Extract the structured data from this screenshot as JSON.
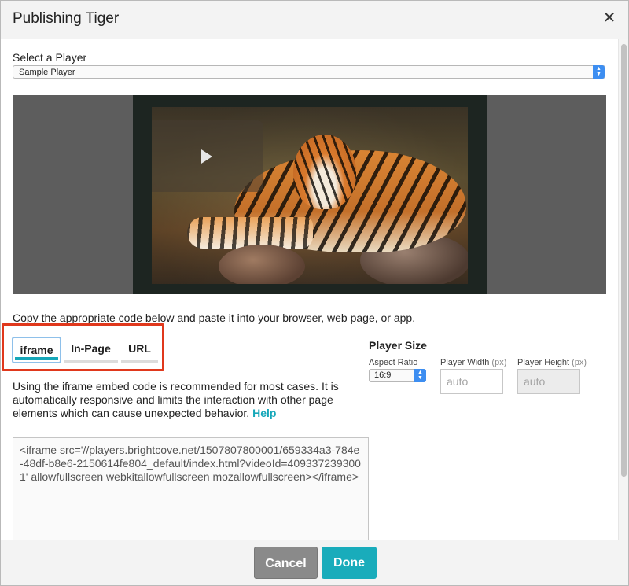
{
  "dialog": {
    "title": "Publishing Tiger",
    "close_symbol": "✕"
  },
  "player_select": {
    "label": "Select a Player",
    "value": "Sample Player"
  },
  "instructions": "Copy the appropriate code below and paste it into your browser, web page, or app.",
  "tabs": [
    {
      "label": "iframe",
      "active": true
    },
    {
      "label": "In-Page",
      "active": false
    },
    {
      "label": "URL",
      "active": false
    }
  ],
  "description": {
    "text": "Using the iframe embed code is recommended for most cases. It is automatically responsive and limits the interaction with other page elements which can cause unexpected behavior.",
    "help_link": "Help"
  },
  "player_size": {
    "title": "Player Size",
    "aspect_ratio_label": "Aspect Ratio",
    "aspect_ratio_value": "16:9",
    "width_label": "Player Width",
    "width_unit": "(px)",
    "width_value": "auto",
    "height_label": "Player Height",
    "height_unit": "(px)",
    "height_value": "auto"
  },
  "embed_code": "<iframe src='//players.brightcove.net/1507807800001/659334a3-784e-48df-b8e6-2150614fe804_default/index.html?videoId=4093372393001' allowfullscreen webkitallowfullscreen mozallowfullscreen></iframe>",
  "footer": {
    "cancel_label": "Cancel",
    "done_label": "Done"
  },
  "colors": {
    "accent": "#19acbb",
    "highlight_border": "#e0381c",
    "select_arrow": "#3d8ef1"
  }
}
